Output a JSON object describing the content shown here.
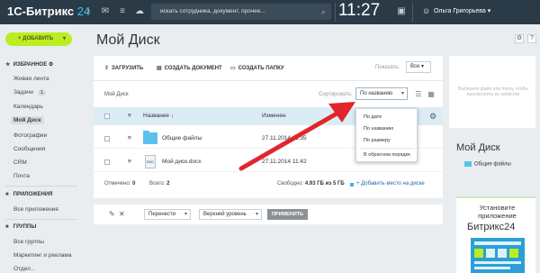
{
  "topbar": {
    "logo_text": "1С-Битрикс",
    "logo_num": "24",
    "search_placeholder": "искать сотрудника, документ, прочее...",
    "clock": "11:27",
    "user_name": "Ольга Григорьева"
  },
  "sidebar": {
    "add_label": "+ ДОБАВИТЬ",
    "favorites_label": "ИЗБРАННОЕ",
    "favorites": [
      {
        "label": "Живая лента"
      },
      {
        "label": "Задачи",
        "badge": "1"
      },
      {
        "label": "Календарь"
      },
      {
        "label": "Мой Диск"
      },
      {
        "label": "Фотографии"
      },
      {
        "label": "Сообщения"
      },
      {
        "label": "CRM"
      },
      {
        "label": "Почта"
      }
    ],
    "apps_label": "ПРИЛОЖЕНИЯ",
    "apps_item": "Все приложения",
    "groups_label": "ГРУППЫ",
    "groups_items": [
      "Все группы",
      "Маркетинг и реклама",
      "Отдел..."
    ]
  },
  "page": {
    "title": "Мой Диск"
  },
  "toolbar": {
    "upload": "ЗАГРУЗИТЬ",
    "create_doc": "СОЗДАТЬ ДОКУМЕНТ",
    "create_folder": "СОЗДАТЬ ПАПКУ",
    "show_label": "Показать:",
    "show_value": "Все"
  },
  "breadcrumb": "Мой Диск",
  "sort": {
    "label": "Сортировать:",
    "value": "По названию",
    "options": [
      "По дате",
      "По названию",
      "По размеру",
      "В обратном порядке"
    ]
  },
  "table": {
    "columns": [
      "Название",
      "Изменен"
    ],
    "rows": [
      {
        "name": "Общие файлы",
        "modified": "27.11.2014 11:35",
        "type": "folder"
      },
      {
        "name": "Мой диск.docx",
        "modified": "27.11.2014 11:42",
        "type": "doc"
      }
    ]
  },
  "footer": {
    "selected_label": "Отмечено:",
    "selected_value": "0",
    "total_label": "Всего:",
    "total_value": "2",
    "free_label": "Свободно:",
    "free_value": "4.93 ГБ из 5 ГБ",
    "add_space": "+ Добавить место на диске"
  },
  "actionbar": {
    "move": "Перенести",
    "level": "Верхний уровень",
    "apply": "ПРИМЕНИТЬ"
  },
  "right": {
    "drop_hint": "Выберите файл или папку, чтобы просмотреть ее свойства",
    "title": "Мой Диск",
    "item": "Общие файлы",
    "promo_title": "Установите приложение",
    "promo_brand": "Битрикс24"
  },
  "colors": {
    "topbar": "#2b3a47",
    "accent_green": "#bbed21",
    "accent_blue": "#2fc6f6",
    "arrow_red": "#e0262c"
  }
}
